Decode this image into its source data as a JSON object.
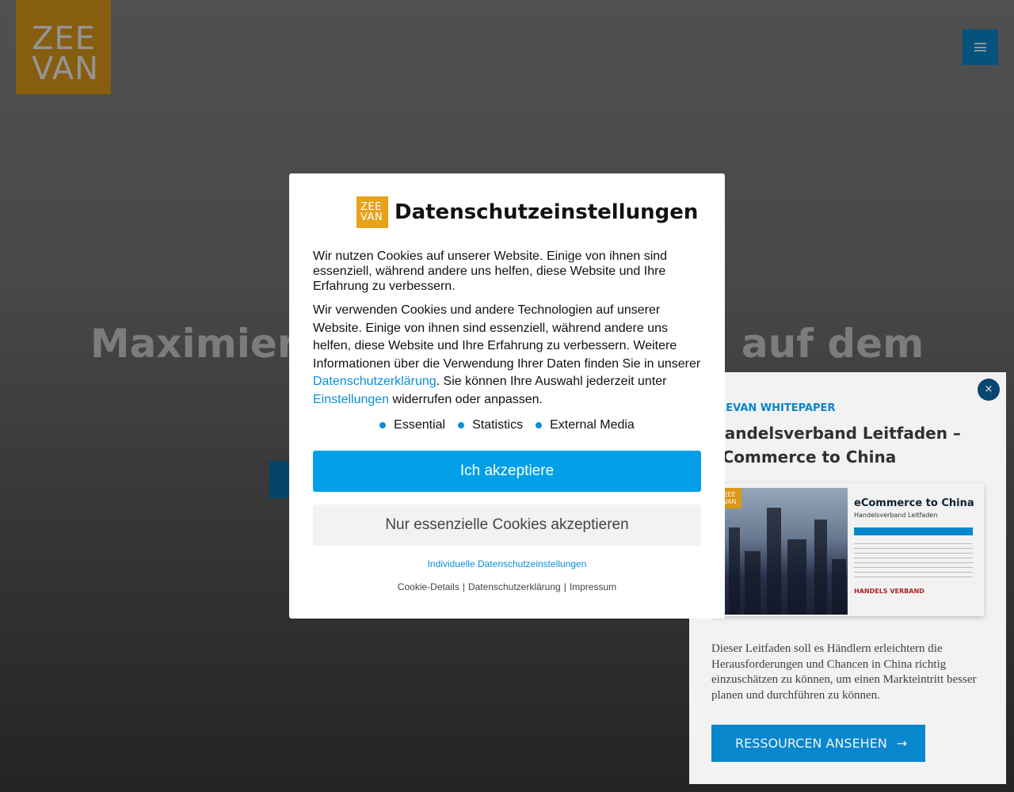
{
  "site": {
    "logo_line1": "ZEE",
    "logo_line2": "VAN",
    "hero_title": "Maximieren Sie Ihr Potential auf dem",
    "menu_icon": "hamburger-icon",
    "brand_color": "#e8a11a",
    "accent_color": "#0a8fd8"
  },
  "cookie_modal": {
    "logo_line1": "ZEE",
    "logo_line2": "VAN",
    "title": "Datenschutzeinstellungen",
    "intro": "Wir nutzen Cookies auf unserer Website. Einige von ihnen sind essenziell, während andere uns helfen, diese Website und Ihre Erfahrung zu verbessern.",
    "details_part1": "Wir verwenden Cookies und andere Technologien auf unserer Website. Einige von ihnen sind essenziell, während andere uns helfen, diese Website und Ihre Erfahrung zu verbessern. Weitere Informationen über die Verwendung Ihrer Daten finden Sie in unserer ",
    "details_link1": "Datenschutzerklärung",
    "details_part2": ". Sie können Ihre Auswahl jederzeit unter ",
    "details_link2": "Einstellungen",
    "details_part3": " widerrufen oder anpassen.",
    "categories": [
      "Essential",
      "Statistics",
      "External Media"
    ],
    "accept_label": "Ich akzeptiere",
    "essential_label": "Nur essenzielle Cookies akzeptieren",
    "individual_label": "Individuelle Datenschutzeinstellungen",
    "footer_links": [
      "Cookie-Details",
      "Datenschutzerklärung",
      "Impressum"
    ],
    "footer_separator": "|"
  },
  "whitepaper": {
    "close_label": "×",
    "tag": "ZEEVAN WHITEPAPER",
    "title": "Handelsverband Leitfaden – eCommerce to China",
    "image_logo_line1": "ZEE",
    "image_logo_line2": "VAN",
    "image_title": "eCommerce to China",
    "image_subtitle": "Handelsverband Leitfaden",
    "image_brand": "HANDELS VERBAND",
    "description": "Dieser Leitfaden soll es Händlern erleichtern die Herausforderungen und Chancen in China richtig einzuschätzen zu können, um einen Markteintritt besser planen und durchführen zu können.",
    "cta_label": "RESSOURCEN ANSEHEN",
    "cta_icon": "arrow-right-icon"
  }
}
